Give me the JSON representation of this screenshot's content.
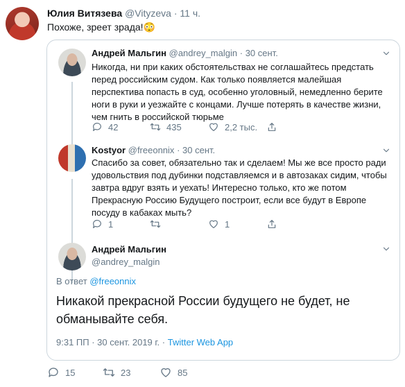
{
  "outer": {
    "name": "Юлия Витязева",
    "handle": "@Vityzeva",
    "sep": "·",
    "time": "11 ч.",
    "text": "Похоже, зреет зрада!😳",
    "replies": "15",
    "retweets": "23",
    "likes": "85"
  },
  "thread": [
    {
      "name": "Андрей Мальгин",
      "handle": "@andrey_malgin",
      "sep": "·",
      "time": "30 сент.",
      "lines": [
        "Никогда, ни при каких обстоятельствах не соглашайтесь предстать",
        "перед российским судом. Как только появляется малейшая",
        "перспектива попасть в суд, особенно уголовный, немедленно берите",
        "ноги в руки и уезжайте с концами. Лучше потерять в качестве жизни,",
        "чем гнить в российской тюрьме"
      ],
      "replies": "42",
      "retweets": "435",
      "likes": "2,2 тыс."
    },
    {
      "name": "Kostyor",
      "handle": "@freeonnix",
      "sep": "·",
      "time": "30 сент.",
      "lines": [
        "Спасибо за совет, обязательно так и сделаем! Мы же все просто ради",
        "удовольствия под дубинки подставляемся и в автозаках сидим, чтобы",
        "завтра вдруг взять и уехать! Интересно только, кто же потом",
        "Прекрасную Россию Будущего построит, если все будут в Европе",
        "посуду в кабаках мыть?"
      ],
      "replies": "1",
      "retweets": "",
      "likes": "1"
    }
  ],
  "main": {
    "name": "Андрей Мальгин",
    "handle": "@andrey_malgin",
    "reply_to_prefix": "В ответ",
    "reply_to_handle": "@freeonnix",
    "line1": "Никакой прекрасной России будущего не будет, не",
    "line2": "обманывайте себя.",
    "timestamp": "9:31 ПП · 30 сент. 2019 г. · ",
    "source": "Twitter Web App"
  },
  "icons": [
    "reply-icon",
    "retweet-icon",
    "like-icon",
    "share-icon",
    "chevron-down-icon"
  ],
  "colors": {
    "link": "#1b95e0",
    "muted": "#657786",
    "border": "#ccd6dd"
  }
}
